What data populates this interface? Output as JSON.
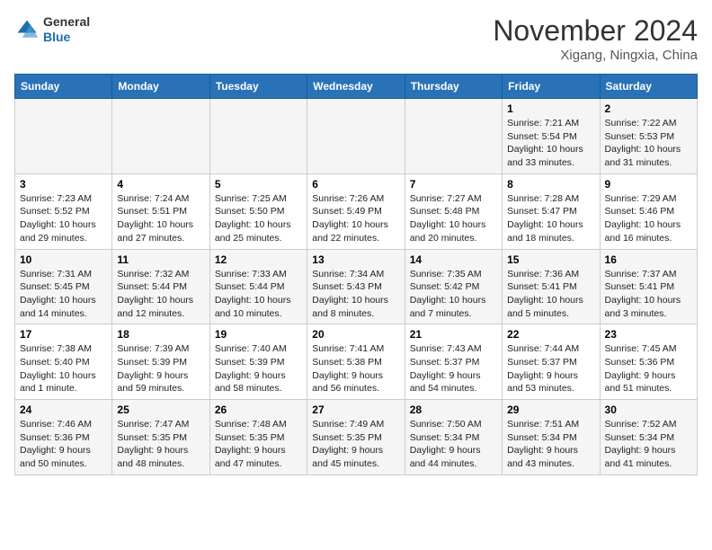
{
  "header": {
    "logo_line1": "General",
    "logo_line2": "Blue",
    "month": "November 2024",
    "location": "Xigang, Ningxia, China"
  },
  "weekdays": [
    "Sunday",
    "Monday",
    "Tuesday",
    "Wednesday",
    "Thursday",
    "Friday",
    "Saturday"
  ],
  "weeks": [
    [
      {
        "day": "",
        "info": ""
      },
      {
        "day": "",
        "info": ""
      },
      {
        "day": "",
        "info": ""
      },
      {
        "day": "",
        "info": ""
      },
      {
        "day": "",
        "info": ""
      },
      {
        "day": "1",
        "info": "Sunrise: 7:21 AM\nSunset: 5:54 PM\nDaylight: 10 hours and 33 minutes."
      },
      {
        "day": "2",
        "info": "Sunrise: 7:22 AM\nSunset: 5:53 PM\nDaylight: 10 hours and 31 minutes."
      }
    ],
    [
      {
        "day": "3",
        "info": "Sunrise: 7:23 AM\nSunset: 5:52 PM\nDaylight: 10 hours and 29 minutes."
      },
      {
        "day": "4",
        "info": "Sunrise: 7:24 AM\nSunset: 5:51 PM\nDaylight: 10 hours and 27 minutes."
      },
      {
        "day": "5",
        "info": "Sunrise: 7:25 AM\nSunset: 5:50 PM\nDaylight: 10 hours and 25 minutes."
      },
      {
        "day": "6",
        "info": "Sunrise: 7:26 AM\nSunset: 5:49 PM\nDaylight: 10 hours and 22 minutes."
      },
      {
        "day": "7",
        "info": "Sunrise: 7:27 AM\nSunset: 5:48 PM\nDaylight: 10 hours and 20 minutes."
      },
      {
        "day": "8",
        "info": "Sunrise: 7:28 AM\nSunset: 5:47 PM\nDaylight: 10 hours and 18 minutes."
      },
      {
        "day": "9",
        "info": "Sunrise: 7:29 AM\nSunset: 5:46 PM\nDaylight: 10 hours and 16 minutes."
      }
    ],
    [
      {
        "day": "10",
        "info": "Sunrise: 7:31 AM\nSunset: 5:45 PM\nDaylight: 10 hours and 14 minutes."
      },
      {
        "day": "11",
        "info": "Sunrise: 7:32 AM\nSunset: 5:44 PM\nDaylight: 10 hours and 12 minutes."
      },
      {
        "day": "12",
        "info": "Sunrise: 7:33 AM\nSunset: 5:44 PM\nDaylight: 10 hours and 10 minutes."
      },
      {
        "day": "13",
        "info": "Sunrise: 7:34 AM\nSunset: 5:43 PM\nDaylight: 10 hours and 8 minutes."
      },
      {
        "day": "14",
        "info": "Sunrise: 7:35 AM\nSunset: 5:42 PM\nDaylight: 10 hours and 7 minutes."
      },
      {
        "day": "15",
        "info": "Sunrise: 7:36 AM\nSunset: 5:41 PM\nDaylight: 10 hours and 5 minutes."
      },
      {
        "day": "16",
        "info": "Sunrise: 7:37 AM\nSunset: 5:41 PM\nDaylight: 10 hours and 3 minutes."
      }
    ],
    [
      {
        "day": "17",
        "info": "Sunrise: 7:38 AM\nSunset: 5:40 PM\nDaylight: 10 hours and 1 minute."
      },
      {
        "day": "18",
        "info": "Sunrise: 7:39 AM\nSunset: 5:39 PM\nDaylight: 9 hours and 59 minutes."
      },
      {
        "day": "19",
        "info": "Sunrise: 7:40 AM\nSunset: 5:39 PM\nDaylight: 9 hours and 58 minutes."
      },
      {
        "day": "20",
        "info": "Sunrise: 7:41 AM\nSunset: 5:38 PM\nDaylight: 9 hours and 56 minutes."
      },
      {
        "day": "21",
        "info": "Sunrise: 7:43 AM\nSunset: 5:37 PM\nDaylight: 9 hours and 54 minutes."
      },
      {
        "day": "22",
        "info": "Sunrise: 7:44 AM\nSunset: 5:37 PM\nDaylight: 9 hours and 53 minutes."
      },
      {
        "day": "23",
        "info": "Sunrise: 7:45 AM\nSunset: 5:36 PM\nDaylight: 9 hours and 51 minutes."
      }
    ],
    [
      {
        "day": "24",
        "info": "Sunrise: 7:46 AM\nSunset: 5:36 PM\nDaylight: 9 hours and 50 minutes."
      },
      {
        "day": "25",
        "info": "Sunrise: 7:47 AM\nSunset: 5:35 PM\nDaylight: 9 hours and 48 minutes."
      },
      {
        "day": "26",
        "info": "Sunrise: 7:48 AM\nSunset: 5:35 PM\nDaylight: 9 hours and 47 minutes."
      },
      {
        "day": "27",
        "info": "Sunrise: 7:49 AM\nSunset: 5:35 PM\nDaylight: 9 hours and 45 minutes."
      },
      {
        "day": "28",
        "info": "Sunrise: 7:50 AM\nSunset: 5:34 PM\nDaylight: 9 hours and 44 minutes."
      },
      {
        "day": "29",
        "info": "Sunrise: 7:51 AM\nSunset: 5:34 PM\nDaylight: 9 hours and 43 minutes."
      },
      {
        "day": "30",
        "info": "Sunrise: 7:52 AM\nSunset: 5:34 PM\nDaylight: 9 hours and 41 minutes."
      }
    ]
  ]
}
